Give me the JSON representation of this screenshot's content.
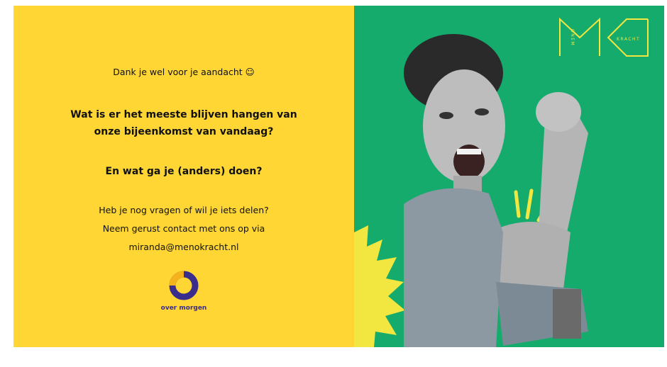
{
  "slide": {
    "thanks": "Dank je wel voor je aandacht ☺",
    "question_line1": "Wat is er het meeste blijven hangen van",
    "question_line2": "onze bijeenkomst van vandaag?",
    "question2": "En wat ga je (anders) doen?",
    "contact_line1": "Heb je nog vragen of wil je iets delen?",
    "contact_line2": "Neem gerust contact met ons op via",
    "contact_email": "miranda@menokracht.nl",
    "logo_text": "over morgen"
  },
  "brand": {
    "logo_letters_1": "ONEM",
    "logo_letters_2": "KRACHT"
  },
  "colors": {
    "yellow_panel": "#ffd633",
    "green_panel": "#14ab6c",
    "logo_purple": "#3b2d8c",
    "logo_yellow": "#f4b21c",
    "brand_yellow": "#f2e640"
  },
  "image": {
    "description": "photo-woman-flexing-arm"
  }
}
